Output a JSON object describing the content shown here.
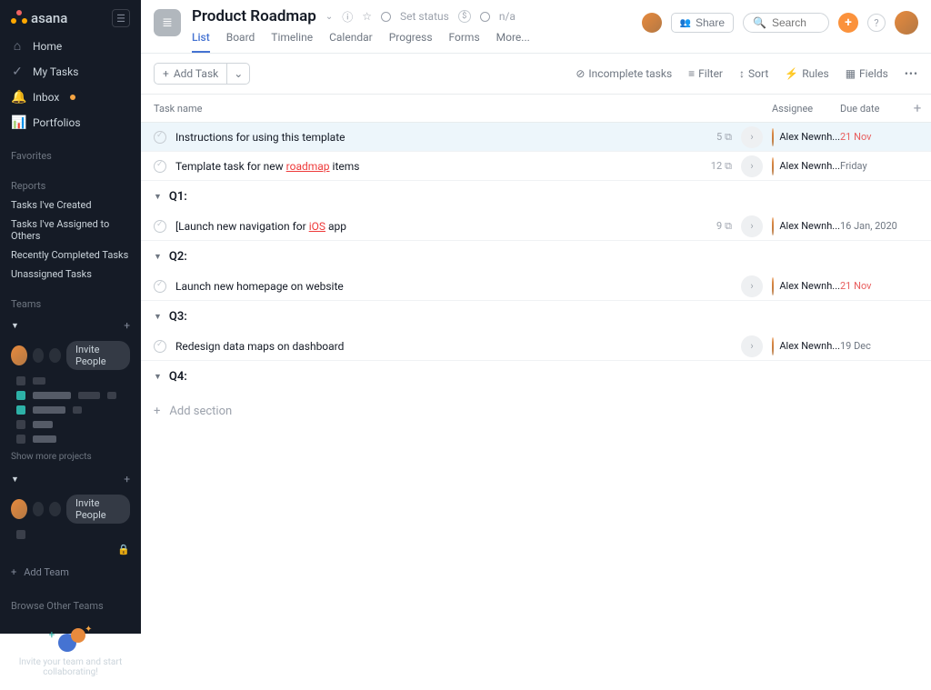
{
  "brand": "asana",
  "sidebar": {
    "nav": [
      {
        "label": "Home"
      },
      {
        "label": "My Tasks"
      },
      {
        "label": "Inbox",
        "has_dot": true
      },
      {
        "label": "Portfolios"
      }
    ],
    "favorites_heading": "Favorites",
    "reports_heading": "Reports",
    "reports": [
      "Tasks I've Created",
      "Tasks I've Assigned to Others",
      "Recently Completed Tasks",
      "Unassigned Tasks"
    ],
    "teams_heading": "Teams",
    "invite_people": "Invite People",
    "show_more": "Show more projects",
    "add_team": "Add Team",
    "browse_teams": "Browse Other Teams",
    "footer_line1": "Invite your team and start",
    "footer_line2": "collaborating!"
  },
  "header": {
    "project_title": "Product Roadmap",
    "set_status": "Set status",
    "na": "n/a",
    "tabs": [
      "List",
      "Board",
      "Timeline",
      "Calendar",
      "Progress",
      "Forms",
      "More..."
    ],
    "share": "Share",
    "search_placeholder": "Search"
  },
  "toolbar": {
    "add_task": "Add Task",
    "incomplete": "Incomplete tasks",
    "filter": "Filter",
    "sort": "Sort",
    "rules": "Rules",
    "fields": "Fields"
  },
  "columns": {
    "task": "Task name",
    "assignee": "Assignee",
    "due": "Due date"
  },
  "assignee_name": "Alex Newnh...",
  "tasks_top": [
    {
      "name": "Instructions for using this template",
      "subtasks": "5",
      "due": "21 Nov",
      "overdue": true,
      "highlight": true
    },
    {
      "name_pre": "Template task for new ",
      "name_red": "roadmap",
      "name_post": " items",
      "subtasks": "12",
      "due": "Friday"
    }
  ],
  "sections": [
    {
      "label": "Q1:",
      "tasks": [
        {
          "name_pre": "[Launch new navigation for ",
          "name_red": "iOS",
          "name_post": " app",
          "subtasks": "9",
          "due": "16 Jan, 2020"
        }
      ]
    },
    {
      "label": "Q2:",
      "tasks": [
        {
          "name": "Launch new homepage on website",
          "due": "21 Nov",
          "overdue": true,
          "no_subtasks": true
        }
      ]
    },
    {
      "label": "Q3:",
      "tasks": [
        {
          "name": "Redesign data maps on dashboard",
          "due": "19 Dec",
          "no_subtasks": true
        }
      ]
    },
    {
      "label": "Q4:",
      "tasks": []
    }
  ],
  "add_section": "Add section"
}
